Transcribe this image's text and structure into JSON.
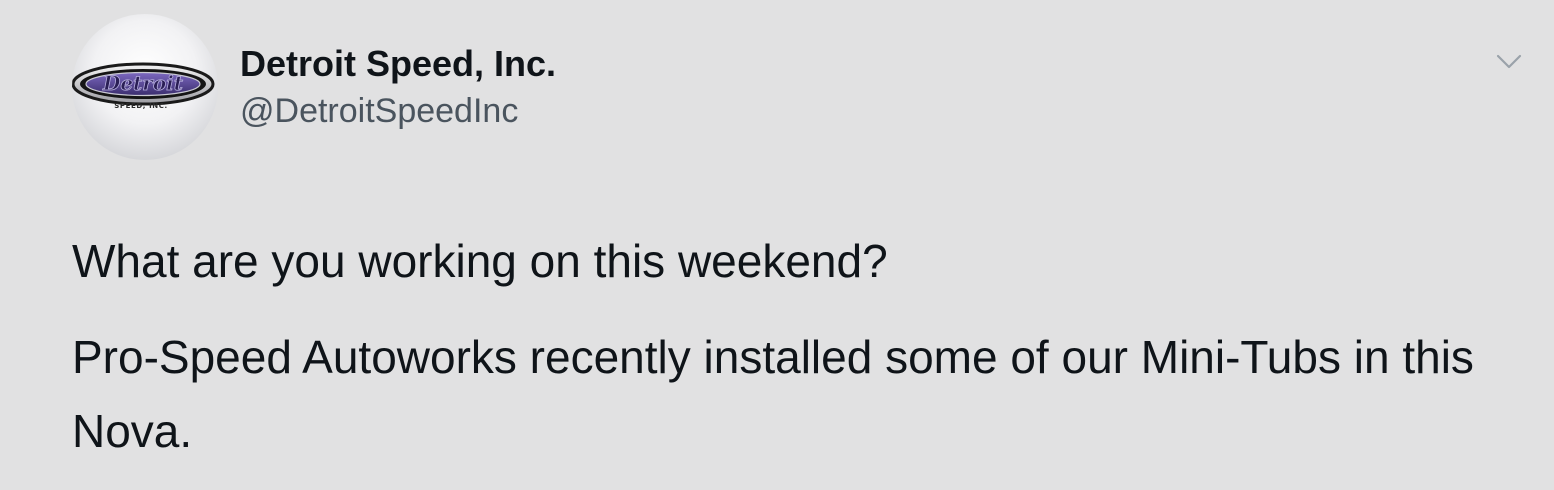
{
  "tweet": {
    "author": {
      "display_name": "Detroit Speed, Inc.",
      "handle": "@DetroitSpeedInc",
      "avatar": {
        "icon": "detroit-speed-logo",
        "logo_text": "Detroit",
        "logo_subtext": "SPEED, INC."
      }
    },
    "menu_icon": "chevron-down-icon",
    "text_lines": [
      "What are you working on this weekend?",
      "Pro-Speed Autoworks recently installed some of our Mini-Tubs in this Nova."
    ]
  },
  "colors": {
    "background": "#e1e1e2",
    "text_primary": "#0f1419",
    "text_secondary": "#4a545e",
    "caret": "#9aa2aa",
    "logo_purple": "#5b4a9a"
  }
}
